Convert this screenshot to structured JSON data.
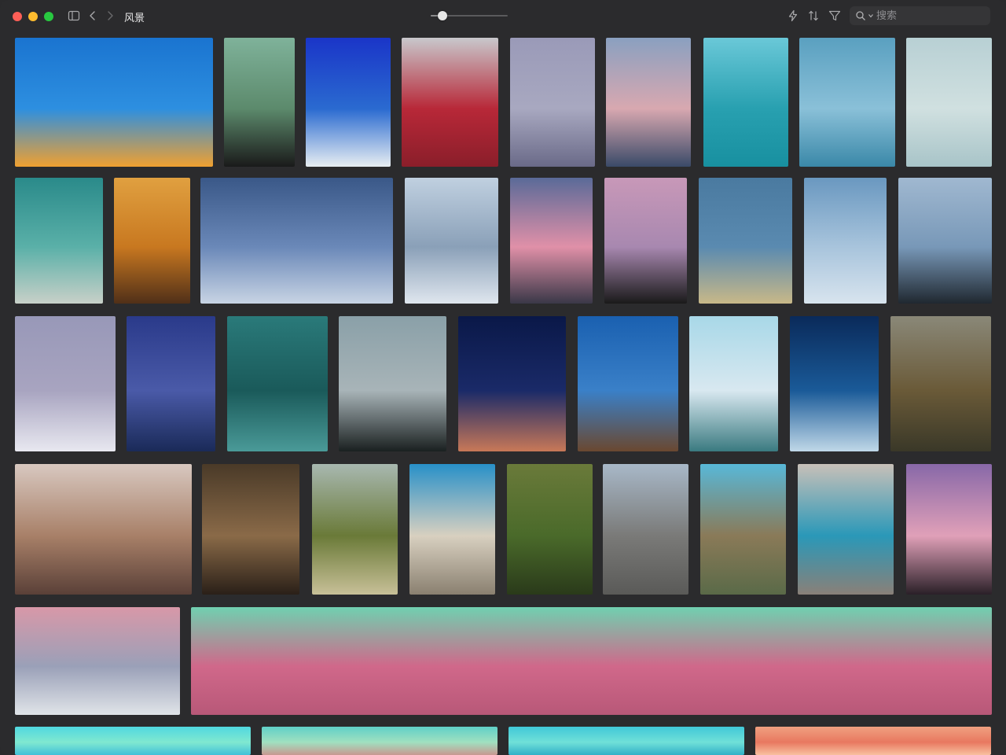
{
  "window": {
    "title": "风景"
  },
  "toolbar": {
    "zoom": 0.15,
    "search_placeholder": "搜索",
    "icons": [
      "sidebar-toggle-icon",
      "back-chevron-icon",
      "forward-chevron-icon",
      "lightning-icon",
      "sort-icon",
      "filter-icon",
      "search-icon",
      "chevron-down-icon"
    ]
  },
  "gallery": {
    "photos": [
      {
        "name": "photo-radio-telescope-sunset",
        "colors": [
          "#1a74d0",
          "#2d8fe0",
          "#f0a030"
        ]
      },
      {
        "name": "photo-power-lines-forest",
        "colors": [
          "#7fb29a",
          "#5c8a6c",
          "#1a1a1a"
        ]
      },
      {
        "name": "photo-blue-ocean-waves",
        "colors": [
          "#1a35c8",
          "#2a6ad0",
          "#e8eef2"
        ]
      },
      {
        "name": "photo-red-hills-clouds",
        "colors": [
          "#c8c8cc",
          "#b82838",
          "#8a1e2a"
        ]
      },
      {
        "name": "photo-moon-cloudy-sky",
        "colors": [
          "#9a9ab8",
          "#a8a8c0",
          "#6a6a88"
        ]
      },
      {
        "name": "photo-sea-of-clouds",
        "colors": [
          "#8aa0c0",
          "#d8a8b0",
          "#3a4a68"
        ]
      },
      {
        "name": "photo-boats-turquoise-sea",
        "colors": [
          "#6ac8d8",
          "#28a0b0",
          "#1890a0"
        ]
      },
      {
        "name": "photo-blue-sky-clouds",
        "colors": [
          "#5aa0c0",
          "#8ac0d8",
          "#3a88a8"
        ]
      },
      {
        "name": "photo-pale-sand-dunes",
        "colors": [
          "#b8d0d4",
          "#d0e0e0",
          "#a8c4c8"
        ]
      },
      {
        "name": "photo-aerial-boats-beach",
        "colors": [
          "#2a8a8a",
          "#5ab0a8",
          "#c8d0c8"
        ]
      },
      {
        "name": "photo-sunset-over-sea",
        "colors": [
          "#e0a040",
          "#c87820",
          "#503018"
        ]
      },
      {
        "name": "photo-snowy-mountain-night",
        "colors": [
          "#3a5888",
          "#6a88b8",
          "#c8d4e4"
        ]
      },
      {
        "name": "photo-cloud-texture",
        "colors": [
          "#c0d0e0",
          "#8aa0b8",
          "#dfe6ee"
        ]
      },
      {
        "name": "photo-pink-sky-clouds",
        "colors": [
          "#5a6a98",
          "#e090a8",
          "#3a3848"
        ]
      },
      {
        "name": "photo-antenna-pink-sky",
        "colors": [
          "#c898b8",
          "#a888b0",
          "#1a1a1a"
        ]
      },
      {
        "name": "photo-crescent-moon-grass",
        "colors": [
          "#4a7aa0",
          "#5a8ab0",
          "#c8b888"
        ]
      },
      {
        "name": "photo-paragliders-sky",
        "colors": [
          "#6a98c0",
          "#a8c4dc",
          "#d8e4ee"
        ]
      },
      {
        "name": "photo-bare-branches-sky",
        "colors": [
          "#a0b8d0",
          "#7898b8",
          "#202830"
        ]
      },
      {
        "name": "photo-lavender-sky",
        "colors": [
          "#9898b8",
          "#a8a4c0",
          "#e8e8f0"
        ]
      },
      {
        "name": "photo-storm-cloud-sea",
        "colors": [
          "#2a3a8a",
          "#4a5aa8",
          "#1a2a58"
        ]
      },
      {
        "name": "photo-green-water-waves",
        "colors": [
          "#2a7a7a",
          "#1a5a5a",
          "#4a9a98"
        ]
      },
      {
        "name": "photo-snowy-peak",
        "colors": [
          "#8aa0a8",
          "#a8b4b8",
          "#1a2020"
        ]
      },
      {
        "name": "photo-night-coast-moon",
        "colors": [
          "#0a1848",
          "#1a2a68",
          "#c87858"
        ]
      },
      {
        "name": "photo-wind-turbine",
        "colors": [
          "#1a60b0",
          "#3a80c8",
          "#6a4830"
        ]
      },
      {
        "name": "photo-pale-sky-mountains",
        "colors": [
          "#a8d8e8",
          "#d8e8f0",
          "#3a7a80"
        ]
      },
      {
        "name": "photo-glacier-lake",
        "colors": [
          "#0a2a5a",
          "#1a5a98",
          "#c0d8e8"
        ]
      },
      {
        "name": "photo-wind-farm-valley",
        "colors": [
          "#8a8878",
          "#6a5a38",
          "#3a3828"
        ]
      },
      {
        "name": "photo-desert-skull",
        "colors": [
          "#d8c8c0",
          "#a88068",
          "#5a4038"
        ]
      },
      {
        "name": "photo-rock-canyon",
        "colors": [
          "#4a3a28",
          "#8a6a48",
          "#2a2018"
        ]
      },
      {
        "name": "photo-green-lake-hills",
        "colors": [
          "#a8b8b0",
          "#6a7a38",
          "#c8c098"
        ]
      },
      {
        "name": "photo-rock-tower",
        "colors": [
          "#2890c8",
          "#d8d0c0",
          "#8a8070"
        ]
      },
      {
        "name": "photo-green-valley",
        "colors": [
          "#6a7a3a",
          "#4a6a2a",
          "#2a3a1a"
        ]
      },
      {
        "name": "photo-desert-road",
        "colors": [
          "#a8b8c8",
          "#7a7a78",
          "#5a5a58"
        ]
      },
      {
        "name": "photo-mountain-road",
        "colors": [
          "#58b8d8",
          "#8a7a58",
          "#5a6a48"
        ]
      },
      {
        "name": "photo-cave-water",
        "colors": [
          "#c8c0b8",
          "#2a98b8",
          "#8a8078"
        ]
      },
      {
        "name": "photo-pink-mountain",
        "colors": [
          "#8868a8",
          "#e0a0b8",
          "#2a2028"
        ]
      },
      {
        "name": "photo-beach-pier-dusk",
        "colors": [
          "#d898a8",
          "#9aa0b8",
          "#e0e4e8"
        ]
      },
      {
        "name": "photo-pink-dune-moon",
        "colors": [
          "#70d0b0",
          "#d0688a",
          "#b85878"
        ]
      },
      {
        "name": "photo-cyan-gradient",
        "colors": [
          "#50d8e0",
          "#80e8d0",
          "#40c0d8"
        ]
      },
      {
        "name": "photo-teal-desert",
        "colors": [
          "#60d0c8",
          "#a0e0c0",
          "#c89890"
        ]
      },
      {
        "name": "photo-cyan-sky",
        "colors": [
          "#40c8d8",
          "#70e0d8",
          "#30b0c8"
        ]
      },
      {
        "name": "photo-orange-dunes",
        "colors": [
          "#f0a080",
          "#e87860",
          "#f8c0a0"
        ]
      }
    ]
  }
}
